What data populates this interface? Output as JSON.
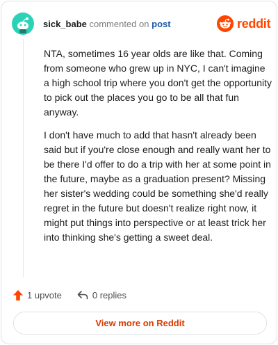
{
  "header": {
    "username": "sick_babe",
    "action_text": "commented on",
    "target_link": "post",
    "avatar_icon": "reddit-snoo-avatar-icon",
    "avatar_color": "#2bd3b6",
    "brand_name": "reddit",
    "brand_icon": "reddit-logo-icon",
    "brand_color": "#ff4500"
  },
  "comment": {
    "paragraphs": [
      "NTA, sometimes 16 year olds are like that. Coming from someone who grew up in NYC, I can't imagine a high school trip where you don't get the opportunity to pick out the places you go to be all that fun anyway.",
      "I don't have much to add that hasn't already been said but if you're close enough and really want her to be there I'd offer to do a trip with her at some point in the future, maybe as a graduation present? Missing her sister's wedding could be something she'd really regret in the future but doesn't realize right now, it might put things into perspective or at least trick her into thinking she's getting a sweet deal."
    ]
  },
  "actions": {
    "upvote_label": "1 upvote",
    "upvote_icon": "upvote-arrow-icon",
    "upvote_color": "#ff4500",
    "replies_label": "0 replies",
    "replies_icon": "reply-arrow-icon"
  },
  "footer": {
    "view_more_label": "View more on Reddit",
    "view_more_color": "#d93a00"
  }
}
